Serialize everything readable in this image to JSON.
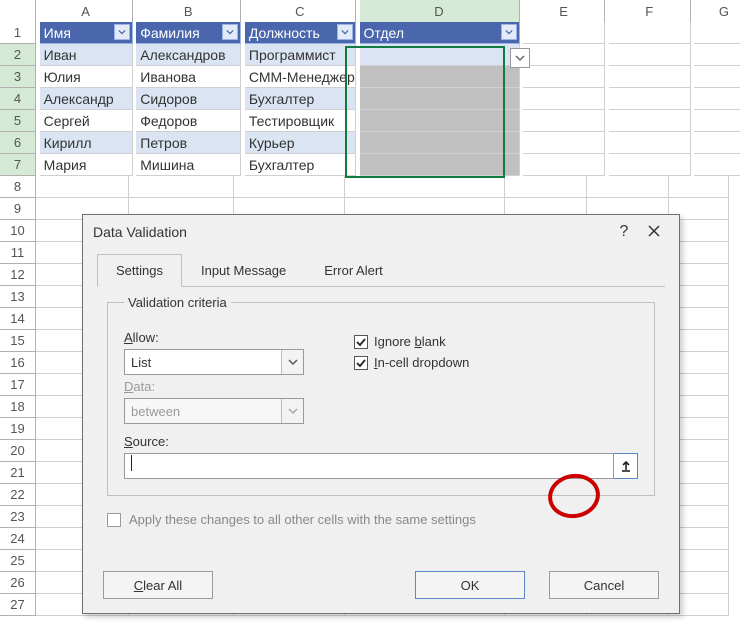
{
  "cols": [
    "A",
    "B",
    "C",
    "D",
    "E",
    "F",
    "G"
  ],
  "rows_shown": 27,
  "table": {
    "headers": [
      "Имя",
      "Фамилия",
      "Должность",
      "Отдел"
    ],
    "rows": [
      [
        "Иван",
        "Александров",
        "Программист",
        ""
      ],
      [
        "Юлия",
        "Иванова",
        "СММ-Менеджер",
        ""
      ],
      [
        "Александр",
        "Сидоров",
        "Бухгалтер",
        ""
      ],
      [
        "Сергей",
        "Федоров",
        "Тестировщик",
        ""
      ],
      [
        "Кирилл",
        "Петров",
        "Курьер",
        ""
      ],
      [
        "Мария",
        "Мишина",
        "Бухгалтер",
        ""
      ]
    ]
  },
  "dialog": {
    "title": "Data Validation",
    "help": "?",
    "tabs": [
      "Settings",
      "Input Message",
      "Error Alert"
    ],
    "active_tab": 0,
    "group_label": "Validation criteria",
    "allow_label_pre": "A",
    "allow_label_suf": "llow:",
    "allow_value": "List",
    "data_label_pre": "D",
    "data_label_suf": "ata:",
    "data_value": "between",
    "ignore_blank_pre": "I",
    "ignore_blank_mid": "gnore ",
    "ignore_blank_u": "b",
    "ignore_blank_suf": "lank",
    "incell_pre": "I",
    "incell_suf": "n-cell dropdown",
    "source_pre": "S",
    "source_suf": "ource:",
    "source_value": "",
    "apply_label": "Apply these changes to all other cells with the same settings",
    "clear_pre": "C",
    "clear_suf": "lear All",
    "ok": "OK",
    "cancel": "Cancel"
  }
}
